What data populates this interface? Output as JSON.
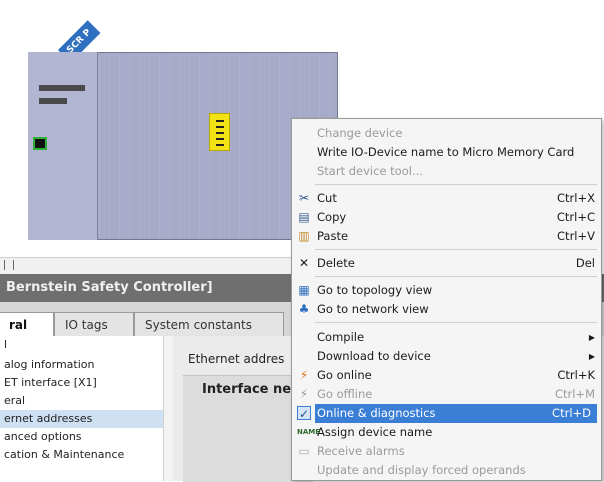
{
  "device": {
    "badge": "SCR P"
  },
  "panel": {
    "title": "Bernstein Safety Controller]",
    "tabs": [
      "ral",
      "IO tags",
      "System constants"
    ],
    "nav_items": [
      "l",
      "alog information",
      "ET interface [X1]",
      "eral",
      "ernet addresses",
      "anced options",
      "cation & Maintenance"
    ],
    "ethernet_label": "Ethernet addres",
    "interface_label": "Interface net"
  },
  "context_menu": {
    "change_device": "Change device",
    "write_io": "Write IO-Device name to Micro Memory Card",
    "start_tool": "Start device tool...",
    "cut": "Cut",
    "cut_sc": "Ctrl+X",
    "copy": "Copy",
    "copy_sc": "Ctrl+C",
    "paste": "Paste",
    "paste_sc": "Ctrl+V",
    "delete": "Delete",
    "delete_sc": "Del",
    "topology": "Go to topology view",
    "network": "Go to network view",
    "compile": "Compile",
    "download": "Download to device",
    "go_online": "Go online",
    "go_online_sc": "Ctrl+K",
    "go_offline": "Go offline",
    "go_offline_sc": "Ctrl+M",
    "diagnostics": "Online & diagnostics",
    "diagnostics_sc": "Ctrl+D",
    "assign_name": "Assign device name",
    "receive_alarms": "Receive alarms",
    "forced": "Update and display forced operands"
  },
  "icons": {
    "cut": "scissors-icon",
    "copy": "copy-icon",
    "paste": "paste-icon",
    "delete": "delete-x-icon",
    "topology": "topology-icon",
    "network": "network-icon",
    "go_online": "go-online-icon",
    "go_offline": "go-offline-icon",
    "diagnostics": "diagnostics-icon",
    "assign_name": "assign-name-icon",
    "receive_alarms": "alarm-icon"
  },
  "colors": {
    "rack": "#a7aac8",
    "highlight": "#3a7fd5",
    "module": "#f3e216",
    "panel_title": "#6f6f6f"
  }
}
